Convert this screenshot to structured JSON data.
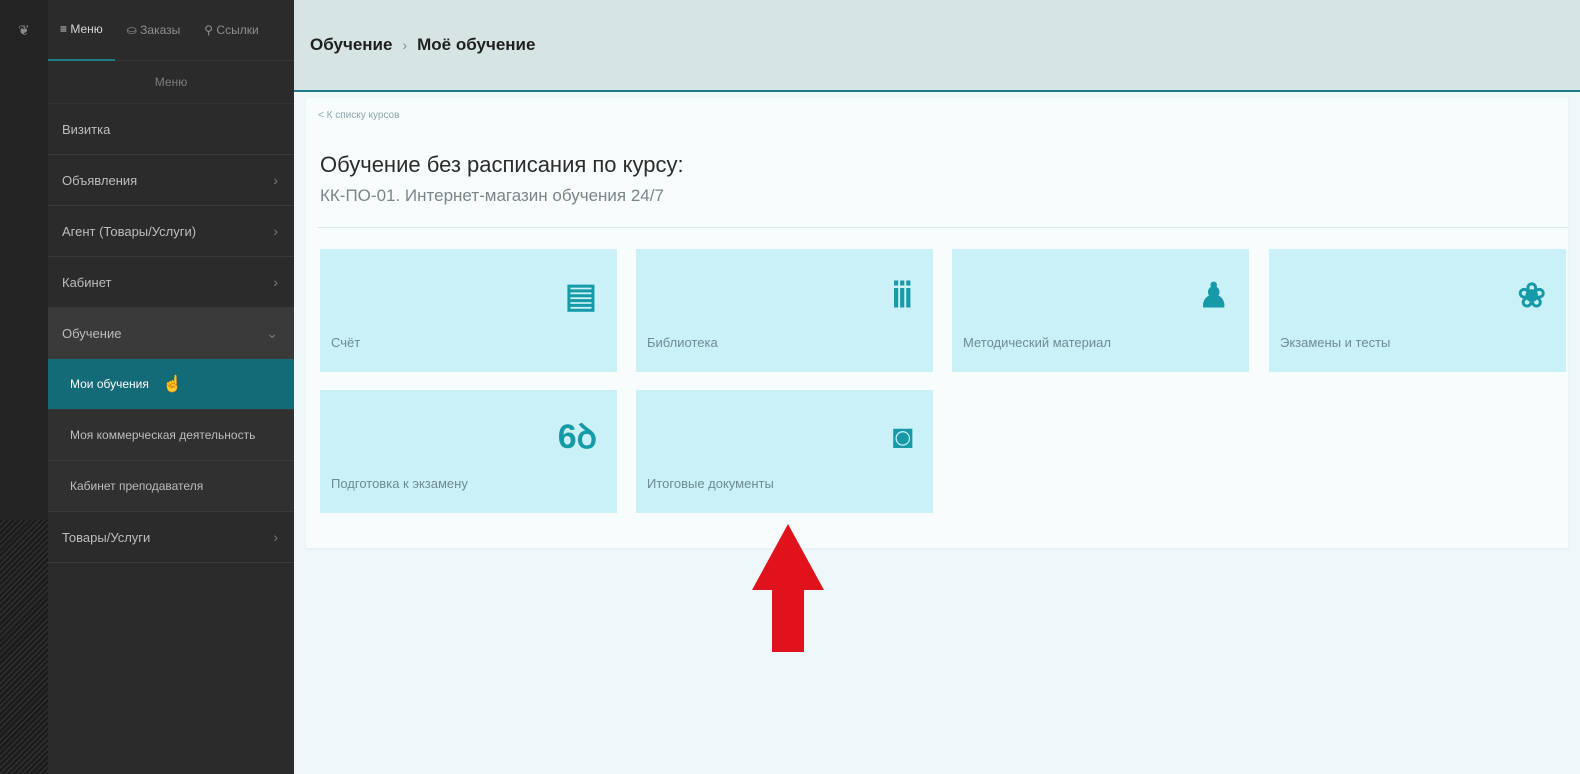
{
  "sidebar": {
    "tabs": [
      {
        "label": "≡ Меню"
      },
      {
        "label": "⛀ Заказы"
      },
      {
        "label": "⚲ Ссылки"
      }
    ],
    "header": "Меню",
    "items": [
      {
        "label": "Визитка"
      },
      {
        "label": "Объявления",
        "chevron": "›"
      },
      {
        "label": "Агент (Товары/Услуги)",
        "chevron": "›"
      },
      {
        "label": "Кабинет",
        "chevron": "›"
      },
      {
        "label": "Обучение",
        "chevron": "⌄"
      }
    ],
    "subitems": [
      {
        "label": "Мои обучения"
      },
      {
        "label": "Моя коммерческая деятельность"
      },
      {
        "label": "Кабинет преподавателя"
      }
    ],
    "last_item": {
      "label": "Товары/Услуги",
      "chevron": "›"
    }
  },
  "breadcrumb": {
    "root": "Обучение",
    "separator": "›",
    "current": "Моё обучение"
  },
  "content": {
    "back_link": "< К списку курсов",
    "title": "Обучение без расписания по курсу:",
    "subtitle": "КК-ПО-01. Интернет-магазин обучения 24/7",
    "tiles": [
      {
        "label": "Счёт",
        "icon": "receipt-icon",
        "glyph": "▤"
      },
      {
        "label": "Библиотека",
        "icon": "books-icon",
        "glyph": "ⅲ"
      },
      {
        "label": "Методический материал",
        "icon": "reader-icon",
        "glyph": "♟"
      },
      {
        "label": "Экзамены и тесты",
        "icon": "brain-icon",
        "glyph": "❀"
      },
      {
        "label": "Подготовка к экзамену",
        "icon": "glasses-icon",
        "glyph": "6ꝺ"
      },
      {
        "label": "Итоговые документы",
        "icon": "certificate-doc-icon",
        "glyph": "◙"
      }
    ]
  },
  "colors": {
    "accent": "#1c7b86",
    "tile_bg": "#c9f1f7",
    "icon": "#169aa8",
    "arrow": "#e0121b"
  }
}
